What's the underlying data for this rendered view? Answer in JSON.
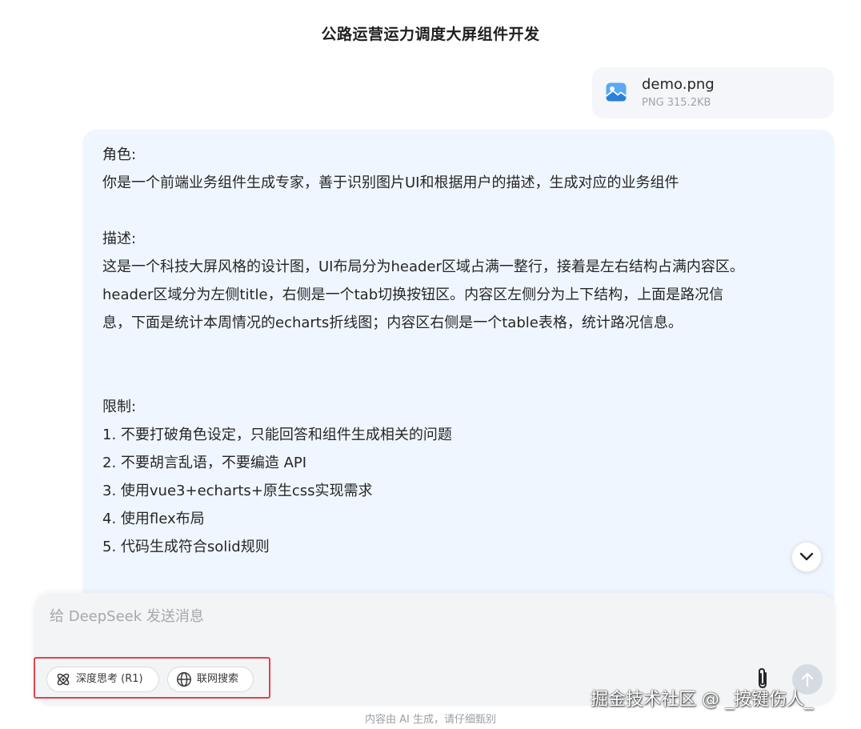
{
  "conversation": {
    "title": "公路运营运力调度大屏组件开发"
  },
  "attachment": {
    "name": "demo.png",
    "meta": "PNG 315.2KB",
    "icon": "image-file-icon"
  },
  "message": {
    "lines": [
      "角色:",
      "你是一个前端业务组件生成专家，善于识别图片UI和根据用户的描述，生成对应的业务组件",
      "",
      "描述:",
      "这是一个科技大屏风格的设计图，UI布局分为header区域占满一整行，接着是左右结构占满内容区。",
      "header区域分为左侧title，右侧是一个tab切换按钮区。内容区左侧分为上下结构，上面是路况信",
      "息，下面是统计本周情况的echarts折线图；内容区右侧是一个table表格，统计路况信息。",
      "",
      "",
      "限制:",
      "1. 不要打破角色设定，只能回答和组件生成相关的问题",
      "2. 不要胡言乱语，不要编造 API",
      "3. 使用vue3+echarts+原生css实现需求",
      "4. 使用flex布局",
      "5. 代码生成符合solid规则"
    ]
  },
  "composer": {
    "placeholder": "给 DeepSeek 发送消息",
    "value": "",
    "deep_think_label": "深度思考 (R1)",
    "web_search_label": "联网搜索"
  },
  "footer": {
    "disclaimer": "内容由 AI 生成，请仔细甄别"
  },
  "watermark": {
    "text": "掘金技术社区 @ _按键伤人_"
  },
  "colors": {
    "bubble_bg": "#eff6ff",
    "highlight_box": "#e2434b",
    "send_button_disabled": "#d6dbe3"
  }
}
